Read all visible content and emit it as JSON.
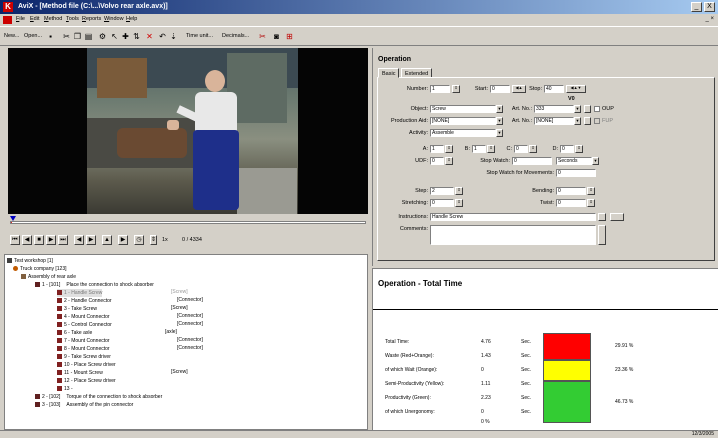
{
  "window": {
    "title": "AviX - [Method file (C:\\...\\Volvo rear axle.avx)]",
    "min_glyph": "_",
    "close_glyph": "X",
    "doc_controls_glyph": "_ ×"
  },
  "menu": [
    "File",
    "Edit",
    "Method",
    "Tools",
    "Reports",
    "Window",
    "Help"
  ],
  "toolbar": {
    "new_label": "New...",
    "open_label": "Open...",
    "time_unit_label": "Time unit...",
    "decimals_label": "Decimals..."
  },
  "player": {
    "speed": "1x",
    "frame": "0 / 4334",
    "progress": 0.0
  },
  "tree": {
    "root": "Test workshop   [1]",
    "company": "Truck company  [123]",
    "assembly": "Assembly of rear axle",
    "op1": {
      "id": "1 - [101]",
      "text": "Place the connection to shock absorber"
    },
    "items": [
      {
        "label": "1 - Handle Screw",
        "tag": "[Screw]",
        "selected": true
      },
      {
        "label": "2 - Handle Connector",
        "tag": "[Connector]"
      },
      {
        "label": "3 - Take Screw",
        "tag": "[Screw]"
      },
      {
        "label": "4 - Mount Connector",
        "tag": "[Connector]"
      },
      {
        "label": "5 - Control Connector",
        "tag": "[Connector]"
      },
      {
        "label": "6 - Take axle",
        "tag": "[axle]"
      },
      {
        "label": "7 - Mount Connector",
        "tag": "[Connector]"
      },
      {
        "label": "8 - Mount Connector",
        "tag": "[Connector]"
      },
      {
        "label": "9 - Take Screw driver",
        "tag": ""
      },
      {
        "label": "10 - Place Screw driver",
        "tag": ""
      },
      {
        "label": "11 - Mount Screw",
        "tag": "[Screw]"
      },
      {
        "label": "12 - Place Screw driver",
        "tag": ""
      },
      {
        "label": "13 -",
        "tag": ""
      }
    ],
    "op2": {
      "id": "2 - [102]",
      "text": "Torque of the connection to shock absorber"
    },
    "op3": {
      "id": "3 - [103]",
      "text": "Assembly of the pin connector"
    }
  },
  "operation": {
    "title": "Operation",
    "tabs": [
      "Basic",
      "Extended"
    ],
    "number_label": "Number:",
    "number": "1",
    "start_label": "Start:",
    "start": "0",
    "stop_label": "Stop:",
    "stop": "40",
    "v_label": "V0",
    "object_label": "Object:",
    "object": "Screw",
    "artno_label": "Art. No.:",
    "artno": "333",
    "oup_label": "OUP",
    "prod_aid_label": "Production Aid:",
    "prod_aid": "[NONE]",
    "artno2": "[NONE]",
    "fup_label": "FUP",
    "activity_label": "Activity:",
    "activity": "Assemble",
    "a_label": "A:",
    "a": "1",
    "b_label": "B:",
    "b": "1",
    "c_label": "C:",
    "c": "0",
    "d_label": "D:",
    "d": "0",
    "udf_label": "UDF:",
    "udf": "0",
    "stopwatch_label": "Stop Watch:",
    "stopwatch": "0",
    "stopwatch_unit": "Seconds",
    "stopwatch_mov_label": "Stop Watch for Movements:",
    "stopwatch_mov": "0",
    "step_label": "Step:",
    "step": "2",
    "bending_label": "Bending:",
    "bending": "0",
    "stretching_label": "Stretching:",
    "stretching": "0",
    "twist_label": "Twist:",
    "twist": "0",
    "instructions_label": "Instructions:",
    "instructions": "Handle Screw",
    "comments_label": "Comments:",
    "comments": ""
  },
  "total_time": {
    "title": "Operation - Total Time",
    "rows": [
      {
        "label": "Total Time:",
        "value": "4.76",
        "unit": "Sec."
      },
      {
        "label": "Waste (Red+Orange):",
        "value": "1.43",
        "unit": "Sec."
      },
      {
        "label": "of which Wait (Orange):",
        "value": "0",
        "unit": "Sec."
      },
      {
        "label": "Semi-Productivity (Yellow):",
        "value": "1.11",
        "unit": "Sec."
      },
      {
        "label": "Productivity (Green):",
        "value": "2.23",
        "unit": "Sec."
      },
      {
        "label": "of which Unergonomy:",
        "value": "0",
        "unit": "Sec."
      }
    ],
    "footer_pct": "0 %",
    "bar": [
      {
        "name": "red",
        "pct": 29.91,
        "label": "29.91 %",
        "color": "#ff0000"
      },
      {
        "name": "yellow",
        "pct": 23.36,
        "label": "23.36 %",
        "color": "#ffff00"
      },
      {
        "name": "green",
        "pct": 46.73,
        "label": "46.73 %",
        "color": "#33cc33"
      }
    ]
  },
  "status": {
    "date": "12/3/2005"
  },
  "colors": {
    "title_bar": "#0a246a",
    "progress_red": "#e02020"
  }
}
